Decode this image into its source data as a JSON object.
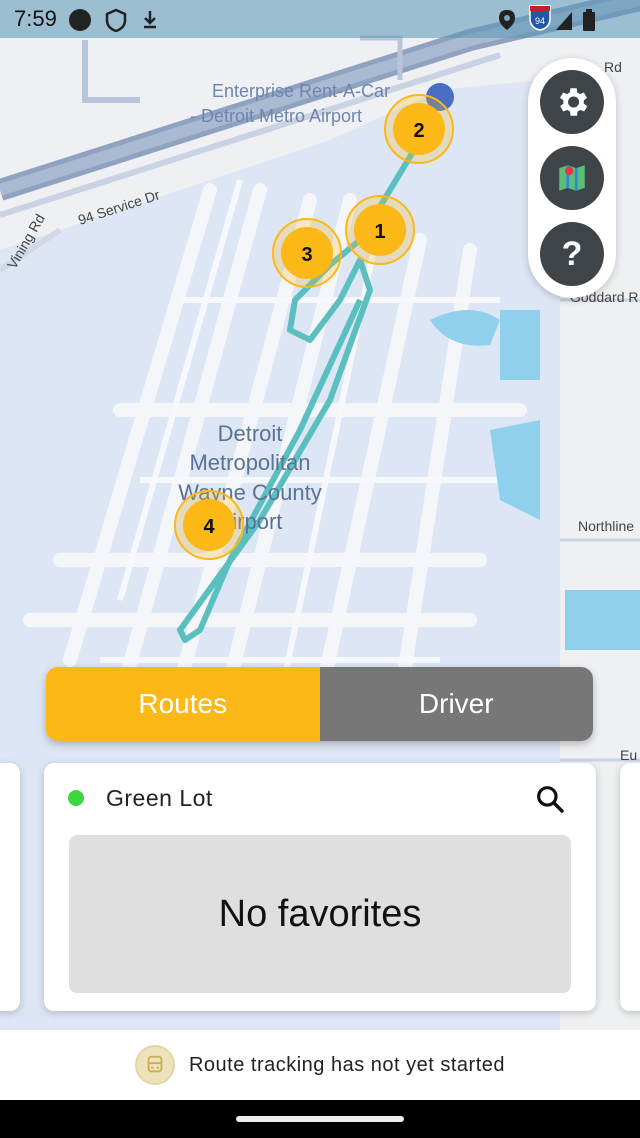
{
  "status_bar": {
    "time": "7:59"
  },
  "map": {
    "labels": {
      "airport_name": [
        "Detroit",
        "Metropolitan",
        "Wayne County",
        "Airport"
      ],
      "enterprise": [
        "Enterprise Rent-A-Car",
        "- Detroit Metro Airport"
      ],
      "service_dr": "94 Service Dr",
      "vining_rd": "Vining Rd",
      "goddard": "Goddard R",
      "northline": "Northline",
      "rd": "Rd",
      "eu": "Eu",
      "highway_shield": "94"
    },
    "stops": [
      {
        "number": "1"
      },
      {
        "number": "2"
      },
      {
        "number": "3"
      },
      {
        "number": "4"
      }
    ],
    "route_color": "#5bbfc0",
    "stop_color": "#fbb817"
  },
  "fab": {
    "settings": "gear-icon",
    "map": "map-icon",
    "help": "?"
  },
  "toggle": {
    "routes_label": "Routes",
    "driver_label": "Driver",
    "active": "Routes"
  },
  "route_card": {
    "lot_name": "Green Lot",
    "status_color": "#3ed63e",
    "favorites_empty": "No favorites"
  },
  "bottom_bar": {
    "tracking_status": "Route tracking has not yet started"
  }
}
